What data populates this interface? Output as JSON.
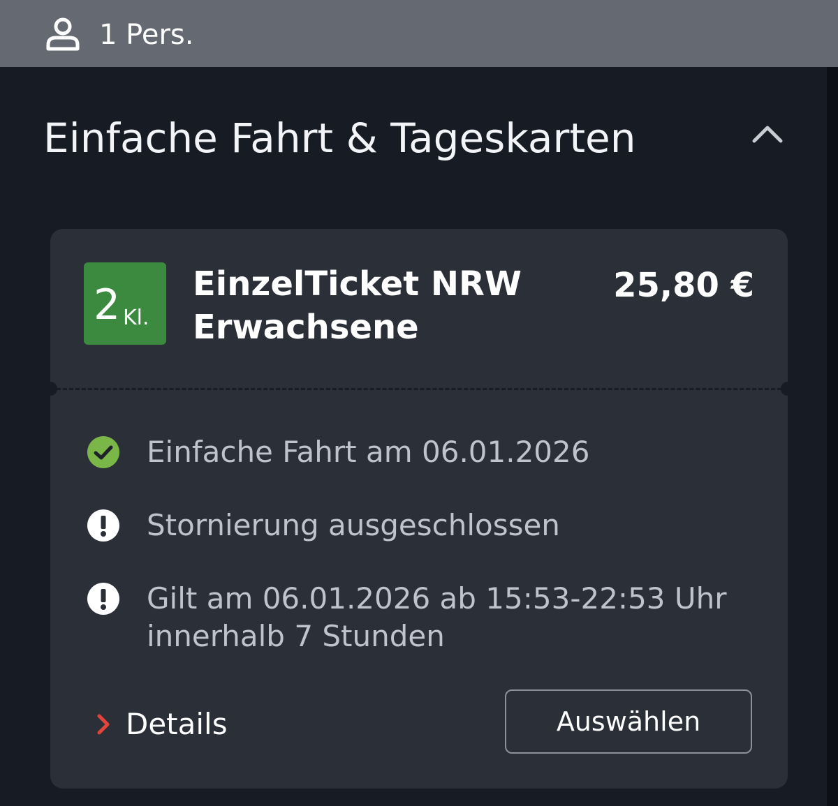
{
  "header": {
    "passengers_label": "1 Pers.",
    "passenger_icon": "person-icon"
  },
  "section": {
    "title": "Einfache Fahrt & Tageskarten",
    "toggle_icon": "chevron-up-icon",
    "expanded": true
  },
  "ticket": {
    "class_number": "2",
    "class_suffix": "Kl.",
    "class_color": "#3b8a3f",
    "name_line1": "EinzelTicket NRW",
    "name_line2": "Erwachsene",
    "price": "25,80 €",
    "features": [
      {
        "icon": "check-circle-icon",
        "color": "#7ab648",
        "text": "Einfache Fahrt am 06.01.2026"
      },
      {
        "icon": "exclamation-circle-icon",
        "color": "#ffffff",
        "text": "Stornierung ausgeschlossen"
      },
      {
        "icon": "exclamation-circle-icon",
        "color": "#ffffff",
        "text_line1": "Gilt am 06.01.2026 ab 15:53-22:53 Uhr",
        "text_line2": "innerhalb 7 Stunden"
      }
    ],
    "details_label": "Details",
    "details_icon": "chevron-right-icon",
    "details_icon_color": "#e3453c",
    "select_label": "Auswählen"
  }
}
